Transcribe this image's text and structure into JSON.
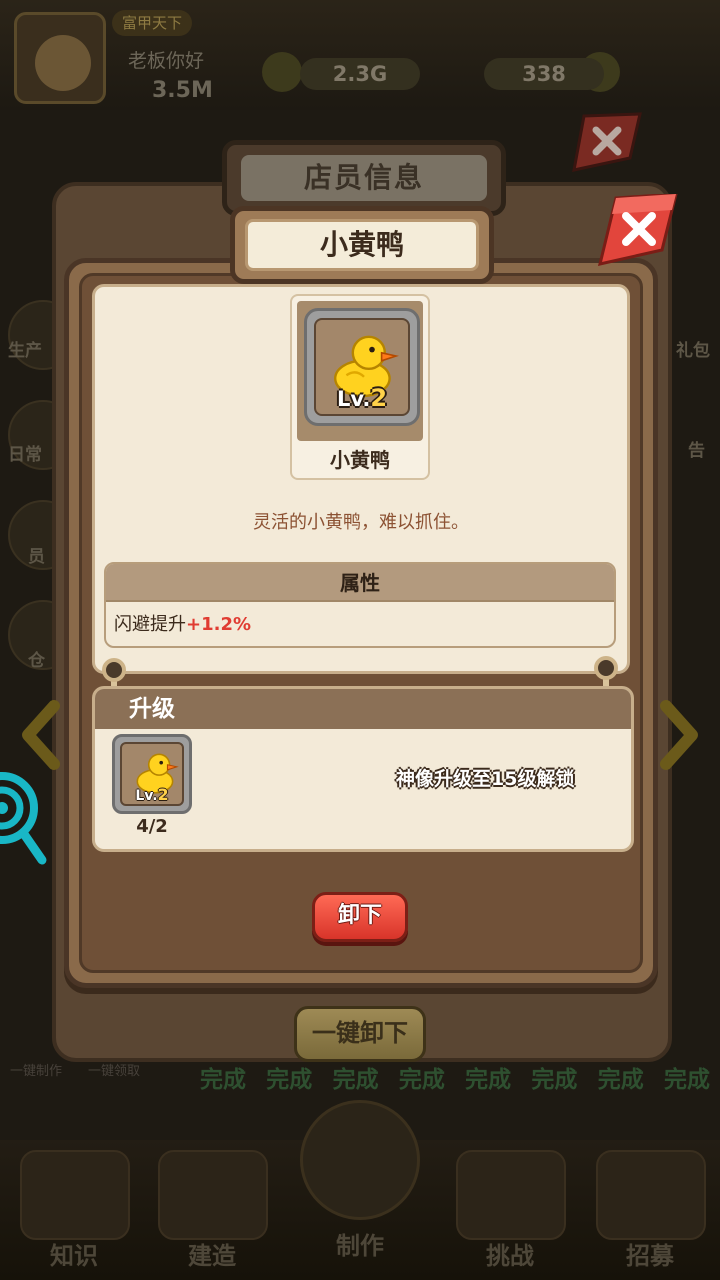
{
  "hud": {
    "title_badge": "富甲天下",
    "greeting": "老板你好",
    "assets": "3.5M",
    "coins": "2.3G",
    "gems": "338"
  },
  "background": {
    "left_menu": [
      "生产",
      "日常",
      "员",
      "仓"
    ],
    "right_menu": [
      "礼包",
      "告"
    ],
    "done_labels": [
      "完成",
      "完成",
      "完成",
      "完成",
      "完成",
      "完成",
      "完成",
      "完成"
    ],
    "small_labels": [
      "一键制作",
      "一键领取"
    ],
    "bottom_nav": [
      "知识",
      "建造",
      "制作",
      "挑战",
      "招募"
    ]
  },
  "dialog_back": {
    "title": "店员信息"
  },
  "dialog": {
    "title": "小黄鸭",
    "staff": {
      "name": "小黄鸭",
      "level_prefix": "Lv.",
      "level": "2",
      "icon": "rubber-duck-icon"
    },
    "description": "灵活的小黄鸭，难以抓住。",
    "attributes": {
      "header": "属性",
      "label": "闪避提升",
      "value": "+1.2%"
    },
    "upgrade": {
      "header": "升级",
      "level_prefix": "Lv.",
      "level": "2",
      "count": "4/2",
      "lock_message": "神像升级至15级解锁"
    },
    "unequip_button": "卸下",
    "unequip_all_button": "一键卸下"
  },
  "colors": {
    "accent_red": "#d8342a",
    "bonus_red": "#e03c32",
    "panel_brown": "#6f5037",
    "parchment": "#f3ead8",
    "duck_yellow": "#ffd21f"
  }
}
